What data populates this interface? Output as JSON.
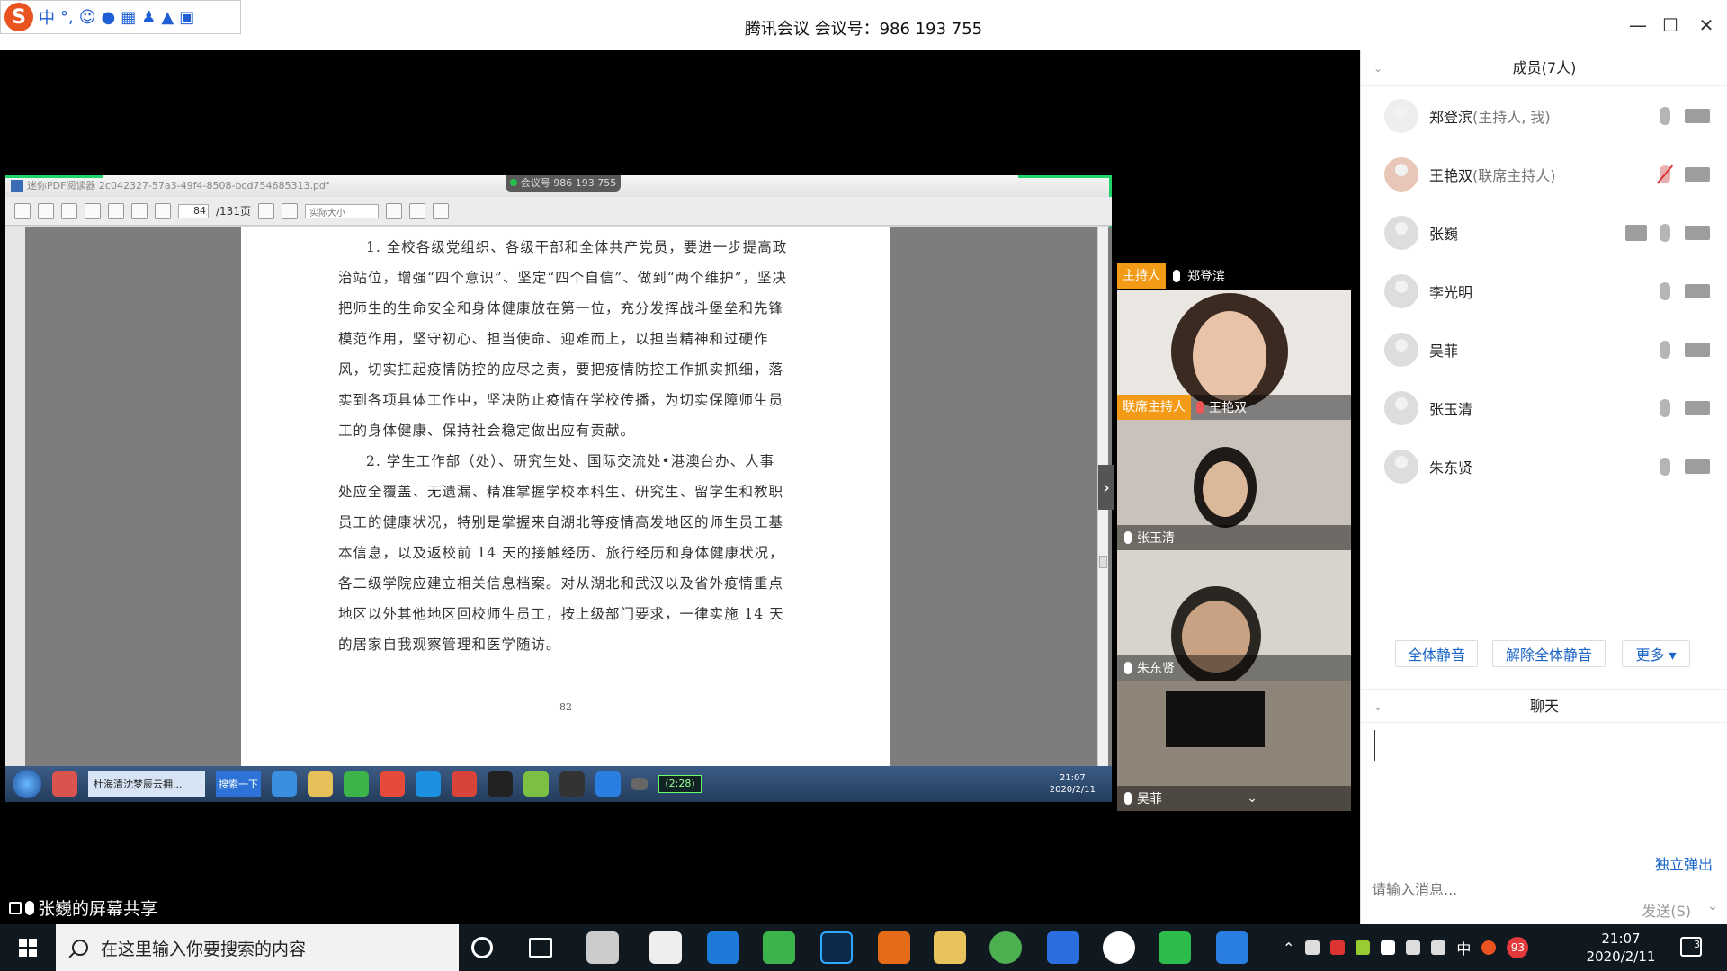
{
  "window": {
    "title": "腾讯会议 会议号：986 193 755"
  },
  "ime": {
    "lang": "中",
    "punct": "°,"
  },
  "shared_screen": {
    "label": "张巍的屏幕共享",
    "pdf_title": "迷你PDF阅读器  2c042327-57a3-49f4-8508-bcd754685313.pdf",
    "meeting_pill": "会议号 986 193 755",
    "page_current": "84",
    "page_total": "/131页",
    "zoom": "实际大小",
    "paragraphs": [
      "1. 全校各级党组织、各级干部和全体共产党员，要进一步提高政治站位，增强“四个意识”、坚定“四个自信”、做到“两个维护”，坚决把师生的生命安全和身体健康放在第一位，充分发挥战斗堡垒和先锋模范作用，坚守初心、担当使命、迎难而上，以担当精神和过硬作风，切实扛起疫情防控的应尽之责，要把疫情防控工作抓实抓细，落实到各项具体工作中，坚决防止疫情在学校传播，为切实保障师生员工的身体健康、保持社会稳定做出应有贡献。",
      "2. 学生工作部（处）、研究生处、国际交流处•港澳台办、人事处应全覆盖、无遗漏、精准掌握学校本科生、研究生、留学生和教职员工的健康状况，特别是掌握来自湖北等疫情高发地区的师生员工基本信息，以及返校前 14 天的接触经历、旅行经历和身体健康状况，各二级学院应建立相关信息档案。对从湖北和武汉以及省外疫情重点地区以外其他地区回校师生员工，按上级部门要求，一律实施 14 天的居家自我观察管理和医学随访。"
    ],
    "page_number": "82",
    "remote_taskbar": {
      "ie_tab": "杜海清沈梦辰云拥...",
      "search_btn": "搜索一下",
      "timer": "(2:28)",
      "time": "21:07",
      "date": "2020/2/11"
    }
  },
  "videos": [
    {
      "tag": "主持人",
      "name": "郑登滨"
    },
    {
      "tag": "联席主持人",
      "name": "王艳双"
    },
    {
      "tag": "",
      "name": "张玉清"
    },
    {
      "tag": "",
      "name": "朱东贤"
    },
    {
      "tag": "",
      "name": "吴菲"
    }
  ],
  "panel": {
    "members_title": "成员(7人)",
    "members": [
      {
        "name": "郑登滨",
        "role": "(主持人, 我)"
      },
      {
        "name": "王艳双",
        "role": "(联席主持人)"
      },
      {
        "name": "张巍",
        "role": ""
      },
      {
        "name": "李光明",
        "role": ""
      },
      {
        "name": "吴菲",
        "role": ""
      },
      {
        "name": "张玉清",
        "role": ""
      },
      {
        "name": "朱东贤",
        "role": ""
      }
    ],
    "btn_mute_all": "全体静音",
    "btn_unmute_all": "解除全体静音",
    "btn_more": "更多 ▾",
    "chat_title": "聊天",
    "popout": "独立弹出",
    "chat_placeholder": "请输入消息...",
    "send": "发送(S)"
  },
  "taskbar": {
    "search_placeholder": "在这里输入你要搜索的内容",
    "ime": "中",
    "badge": "93",
    "time": "21:07",
    "date": "2020/2/11",
    "notif_count": "3"
  }
}
